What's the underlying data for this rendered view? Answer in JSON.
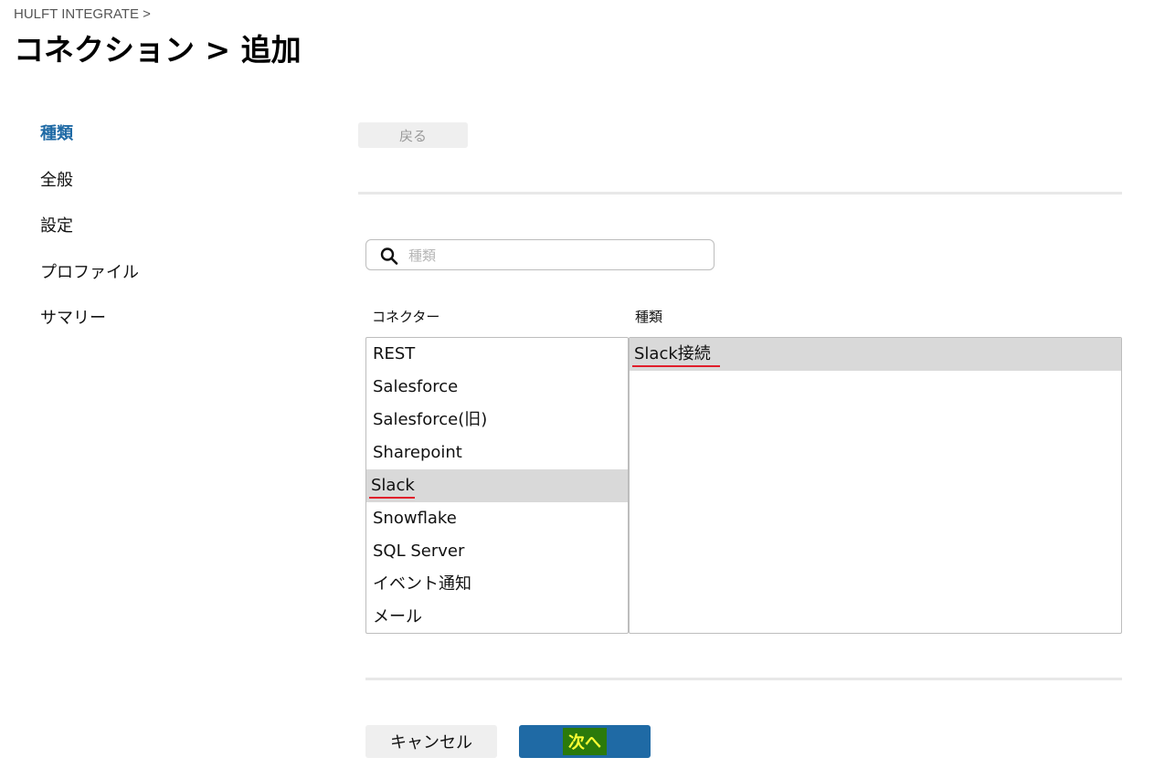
{
  "header": {
    "breadcrumb": "HULFT INTEGRATE >",
    "title": "コネクション > 追加"
  },
  "steps": [
    {
      "label": "種類",
      "active": true
    },
    {
      "label": "全般",
      "active": false
    },
    {
      "label": "設定",
      "active": false
    },
    {
      "label": "プロファイル",
      "active": false
    },
    {
      "label": "サマリー",
      "active": false
    }
  ],
  "toolbar": {
    "back_label": "戻る"
  },
  "search": {
    "placeholder": "種類",
    "value": ""
  },
  "columns": {
    "connector_header": "コネクター",
    "type_header": "種類"
  },
  "connectors": [
    {
      "label": "REST"
    },
    {
      "label": "Salesforce"
    },
    {
      "label": "Salesforce(旧)"
    },
    {
      "label": "Sharepoint"
    },
    {
      "label": "Slack",
      "selected": true
    },
    {
      "label": "Snowflake"
    },
    {
      "label": "SQL Server"
    },
    {
      "label": "イベント通知"
    },
    {
      "label": "メール"
    }
  ],
  "types": [
    {
      "label": "Slack接続",
      "selected": true
    }
  ],
  "footer": {
    "cancel_label": "キャンセル",
    "next_label": "次へ"
  },
  "colors": {
    "accent": "#1f6aa5",
    "selection": "#d9d9d9",
    "underline": "#e01e2b",
    "highlight_bg": "#2b7a0b",
    "highlight_text": "#ffff33"
  }
}
